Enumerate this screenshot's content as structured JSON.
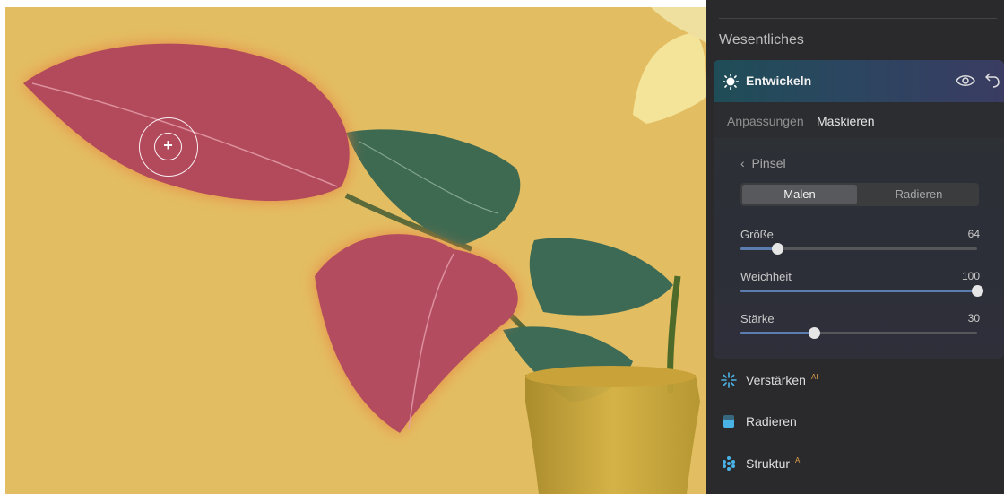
{
  "panel": {
    "section_title": "Wesentliches",
    "develop": {
      "label": "Entwickeln",
      "icons": [
        "sun-icon",
        "eye-icon",
        "undo-icon"
      ]
    },
    "tabs": {
      "adjustments": "Anpassungen",
      "masking": "Maskieren"
    },
    "brush": {
      "back_label": "Pinsel",
      "mode_paint": "Malen",
      "mode_erase": "Radieren",
      "selected_mode": "Malen",
      "sliders": [
        {
          "label": "Größe",
          "value": "64",
          "fraction": 0.155
        },
        {
          "label": "Weichheit",
          "value": "100",
          "fraction": 1.0
        },
        {
          "label": "Stärke",
          "value": "30",
          "fraction": 0.31
        }
      ]
    },
    "tools": [
      {
        "label": "Verstärken",
        "badge": "AI",
        "icon": "sparkle-icon"
      },
      {
        "label": "Radieren",
        "badge": "",
        "icon": "eraser-icon"
      },
      {
        "label": "Struktur",
        "badge": "AI",
        "icon": "structure-icon"
      }
    ]
  },
  "colors": {
    "accent_blue": "#4ab3e6",
    "slider_fill": "#5b7db0",
    "ai_badge": "#e4a24a",
    "photo_background": "#e3bd62"
  }
}
